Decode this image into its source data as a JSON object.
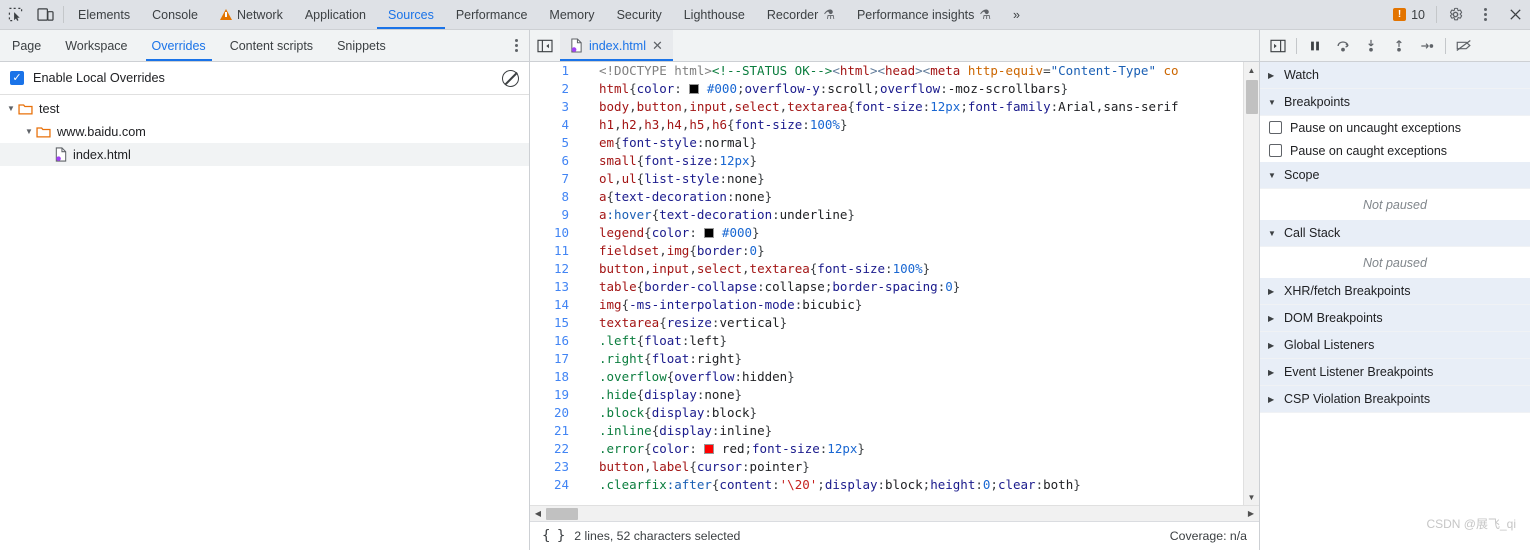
{
  "topbar": {
    "icons": [
      {
        "name": "inspect-element-icon"
      },
      {
        "name": "device-toolbar-icon"
      }
    ],
    "tabs": [
      {
        "label": "Elements",
        "active": false,
        "warn": false,
        "flask": false
      },
      {
        "label": "Console",
        "active": false,
        "warn": false,
        "flask": false
      },
      {
        "label": "Network",
        "active": false,
        "warn": true,
        "flask": false
      },
      {
        "label": "Application",
        "active": false,
        "warn": false,
        "flask": false
      },
      {
        "label": "Sources",
        "active": true,
        "warn": false,
        "flask": false
      },
      {
        "label": "Performance",
        "active": false,
        "warn": false,
        "flask": false
      },
      {
        "label": "Memory",
        "active": false,
        "warn": false,
        "flask": false
      },
      {
        "label": "Security",
        "active": false,
        "warn": false,
        "flask": false
      },
      {
        "label": "Lighthouse",
        "active": false,
        "warn": false,
        "flask": false
      },
      {
        "label": "Recorder",
        "active": false,
        "warn": false,
        "flask": true
      },
      {
        "label": "Performance insights",
        "active": false,
        "warn": false,
        "flask": true
      }
    ],
    "more_tabs_label": "»",
    "error_count": "10",
    "settings_icon": "gear-icon",
    "more_icon": "kebab-menu-icon",
    "close_icon": "close-icon"
  },
  "navigator": {
    "tabs": [
      {
        "label": "Page",
        "active": false
      },
      {
        "label": "Workspace",
        "active": false
      },
      {
        "label": "Overrides",
        "active": true
      },
      {
        "label": "Content scripts",
        "active": false
      },
      {
        "label": "Snippets",
        "active": false
      }
    ],
    "more_icon": "kebab-menu-icon",
    "overrides": {
      "checkbox_label": "Enable Local Overrides",
      "checkbox_checked": true,
      "checkmark": "✓",
      "clear_icon": "clear-overrides-icon"
    },
    "tree": [
      {
        "label": "test",
        "type": "folder",
        "depth": 0,
        "expanded": true,
        "selected": false
      },
      {
        "label": "www.baidu.com",
        "type": "folder",
        "depth": 1,
        "expanded": true,
        "selected": false
      },
      {
        "label": "index.html",
        "type": "file",
        "depth": 2,
        "expanded": false,
        "selected": true
      }
    ]
  },
  "editor": {
    "panel_toggle_icon": "show-navigator-icon",
    "tab": {
      "label": "index.html",
      "file_icon": "html-file-icon",
      "close_icon": "close-tab-icon"
    },
    "lines": [
      {
        "n": "1",
        "html": "<span class=\"s-doct\">&lt;!DOCTYPE html&gt;</span><span class=\"s-cmt\">&lt;!--STATUS OK--&gt;</span><span class=\"s-brack\">&lt;</span><span class=\"s-tag\">html</span><span class=\"s-brack\">&gt;&lt;</span><span class=\"s-tag\">head</span><span class=\"s-brack\">&gt;&lt;</span><span class=\"s-tag\">meta</span> <span class=\"s-attr\">http-equiv</span><span class=\"s-punct\">=</span><span class=\"s-attrv\">\"Content-Type\"</span> <span class=\"s-attr\">co</span>"
      },
      {
        "n": "2",
        "html": "<span class=\"s-sel\">html</span><span class=\"s-punct\">{</span><span class=\"s-prop\">color</span><span class=\"s-punct\">:</span> <span class=\"swatch-b\"></span> <span class=\"s-num\">#000</span><span class=\"s-punct\">;</span><span class=\"s-prop\">overflow-y</span><span class=\"s-punct\">:</span><span class=\"s-val\">scroll</span><span class=\"s-punct\">;</span><span class=\"s-prop\">overflow</span><span class=\"s-punct\">:</span><span class=\"s-val\">-moz-scrollbars</span><span class=\"s-punct\">}</span>"
      },
      {
        "n": "3",
        "html": "<span class=\"s-sel\">body</span><span class=\"s-punct\">,</span><span class=\"s-sel\">button</span><span class=\"s-punct\">,</span><span class=\"s-sel\">input</span><span class=\"s-punct\">,</span><span class=\"s-sel\">select</span><span class=\"s-punct\">,</span><span class=\"s-sel\">textarea</span><span class=\"s-punct\">{</span><span class=\"s-prop\">font-size</span><span class=\"s-punct\">:</span><span class=\"s-num\">12px</span><span class=\"s-punct\">;</span><span class=\"s-prop\">font-family</span><span class=\"s-punct\">:</span><span class=\"s-val\">Arial,sans-serif</span>"
      },
      {
        "n": "4",
        "html": "<span class=\"s-sel\">h1</span><span class=\"s-punct\">,</span><span class=\"s-sel\">h2</span><span class=\"s-punct\">,</span><span class=\"s-sel\">h3</span><span class=\"s-punct\">,</span><span class=\"s-sel\">h4</span><span class=\"s-punct\">,</span><span class=\"s-sel\">h5</span><span class=\"s-punct\">,</span><span class=\"s-sel\">h6</span><span class=\"s-punct\">{</span><span class=\"s-prop\">font-size</span><span class=\"s-punct\">:</span><span class=\"s-num\">100%</span><span class=\"s-punct\">}</span>"
      },
      {
        "n": "5",
        "html": "<span class=\"s-sel\">em</span><span class=\"s-punct\">{</span><span class=\"s-prop\">font-style</span><span class=\"s-punct\">:</span><span class=\"s-val\">normal</span><span class=\"s-punct\">}</span>"
      },
      {
        "n": "6",
        "html": "<span class=\"s-sel\">small</span><span class=\"s-punct\">{</span><span class=\"s-prop\">font-size</span><span class=\"s-punct\">:</span><span class=\"s-num\">12px</span><span class=\"s-punct\">}</span>"
      },
      {
        "n": "7",
        "html": "<span class=\"s-sel\">ol</span><span class=\"s-punct\">,</span><span class=\"s-sel\">ul</span><span class=\"s-punct\">{</span><span class=\"s-prop\">list-style</span><span class=\"s-punct\">:</span><span class=\"s-val\">none</span><span class=\"s-punct\">}</span>"
      },
      {
        "n": "8",
        "html": "<span class=\"s-sel\">a</span><span class=\"s-punct\">{</span><span class=\"s-prop\">text-decoration</span><span class=\"s-punct\">:</span><span class=\"s-val\">none</span><span class=\"s-punct\">}</span>"
      },
      {
        "n": "9",
        "html": "<span class=\"s-sel\">a</span><span class=\"s-pseu\">:hover</span><span class=\"s-punct\">{</span><span class=\"s-prop\">text-decoration</span><span class=\"s-punct\">:</span><span class=\"s-val\">underline</span><span class=\"s-punct\">}</span>"
      },
      {
        "n": "10",
        "html": "<span class=\"s-sel\">legend</span><span class=\"s-punct\">{</span><span class=\"s-prop\">color</span><span class=\"s-punct\">:</span> <span class=\"swatch-b\"></span> <span class=\"s-num\">#000</span><span class=\"s-punct\">}</span>"
      },
      {
        "n": "11",
        "html": "<span class=\"s-sel\">fieldset</span><span class=\"s-punct\">,</span><span class=\"s-sel\">img</span><span class=\"s-punct\">{</span><span class=\"s-prop\">border</span><span class=\"s-punct\">:</span><span class=\"s-num\">0</span><span class=\"s-punct\">}</span>"
      },
      {
        "n": "12",
        "html": "<span class=\"s-sel\">button</span><span class=\"s-punct\">,</span><span class=\"s-sel\">input</span><span class=\"s-punct\">,</span><span class=\"s-sel\">select</span><span class=\"s-punct\">,</span><span class=\"s-sel\">textarea</span><span class=\"s-punct\">{</span><span class=\"s-prop\">font-size</span><span class=\"s-punct\">:</span><span class=\"s-num\">100%</span><span class=\"s-punct\">}</span>"
      },
      {
        "n": "13",
        "html": "<span class=\"s-sel\">table</span><span class=\"s-punct\">{</span><span class=\"s-prop\">border-collapse</span><span class=\"s-punct\">:</span><span class=\"s-val\">collapse</span><span class=\"s-punct\">;</span><span class=\"s-prop\">border-spacing</span><span class=\"s-punct\">:</span><span class=\"s-num\">0</span><span class=\"s-punct\">}</span>"
      },
      {
        "n": "14",
        "html": "<span class=\"s-sel\">img</span><span class=\"s-punct\">{</span><span class=\"s-prop\">-ms-interpolation-mode</span><span class=\"s-punct\">:</span><span class=\"s-val\">bicubic</span><span class=\"s-punct\">}</span>"
      },
      {
        "n": "15",
        "html": "<span class=\"s-sel\">textarea</span><span class=\"s-punct\">{</span><span class=\"s-prop\">resize</span><span class=\"s-punct\">:</span><span class=\"s-val\">vertical</span><span class=\"s-punct\">}</span>"
      },
      {
        "n": "16",
        "html": "<span class=\"s-cls\">.left</span><span class=\"s-punct\">{</span><span class=\"s-prop\">float</span><span class=\"s-punct\">:</span><span class=\"s-val\">left</span><span class=\"s-punct\">}</span>"
      },
      {
        "n": "17",
        "html": "<span class=\"s-cls\">.right</span><span class=\"s-punct\">{</span><span class=\"s-prop\">float</span><span class=\"s-punct\">:</span><span class=\"s-val\">right</span><span class=\"s-punct\">}</span>"
      },
      {
        "n": "18",
        "html": "<span class=\"s-cls\">.overflow</span><span class=\"s-punct\">{</span><span class=\"s-prop\">overflow</span><span class=\"s-punct\">:</span><span class=\"s-val\">hidden</span><span class=\"s-punct\">}</span>"
      },
      {
        "n": "19",
        "html": "<span class=\"s-cls\">.hide</span><span class=\"s-punct\">{</span><span class=\"s-prop\">display</span><span class=\"s-punct\">:</span><span class=\"s-val\">none</span><span class=\"s-punct\">}</span>"
      },
      {
        "n": "20",
        "html": "<span class=\"s-cls\">.block</span><span class=\"s-punct\">{</span><span class=\"s-prop\">display</span><span class=\"s-punct\">:</span><span class=\"s-val\">block</span><span class=\"s-punct\">}</span>"
      },
      {
        "n": "21",
        "html": "<span class=\"s-cls\">.inline</span><span class=\"s-punct\">{</span><span class=\"s-prop\">display</span><span class=\"s-punct\">:</span><span class=\"s-val\">inline</span><span class=\"s-punct\">}</span>"
      },
      {
        "n": "22",
        "html": "<span class=\"s-cls\">.error</span><span class=\"s-punct\">{</span><span class=\"s-prop\">color</span><span class=\"s-punct\">:</span> <span class=\"swatch-r\"></span> <span class=\"s-val\">red</span><span class=\"s-punct\">;</span><span class=\"s-prop\">font-size</span><span class=\"s-punct\">:</span><span class=\"s-num\">12px</span><span class=\"s-punct\">}</span>"
      },
      {
        "n": "23",
        "html": "<span class=\"s-sel\">button</span><span class=\"s-punct\">,</span><span class=\"s-sel\">label</span><span class=\"s-punct\">{</span><span class=\"s-prop\">cursor</span><span class=\"s-punct\">:</span><span class=\"s-val\">pointer</span><span class=\"s-punct\">}</span>"
      },
      {
        "n": "24",
        "html": "<span class=\"s-cls\">.clearfix</span><span class=\"s-pseu\">:after</span><span class=\"s-punct\">{</span><span class=\"s-prop\">content</span><span class=\"s-punct\">:</span><span class=\"s-str\">'\\20'</span><span class=\"s-punct\">;</span><span class=\"s-prop\">display</span><span class=\"s-punct\">:</span><span class=\"s-val\">block</span><span class=\"s-punct\">;</span><span class=\"s-prop\">height</span><span class=\"s-punct\">:</span><span class=\"s-num\">0</span><span class=\"s-punct\">;</span><span class=\"s-prop\">clear</span><span class=\"s-punct\">:</span><span class=\"s-val\">both</span><span class=\"s-punct\">}</span>"
      }
    ],
    "statusbar": {
      "format_icon": "pretty-print-icon",
      "format_glyph": "{ }",
      "selection_text": "2 lines, 52 characters selected",
      "coverage_text": "Coverage: n/a"
    }
  },
  "debugger": {
    "toolbar_icons": [
      {
        "name": "show-debugger-sidebar-icon"
      },
      {
        "name": "pause-script-icon"
      },
      {
        "name": "step-over-icon"
      },
      {
        "name": "step-into-icon"
      },
      {
        "name": "step-out-icon"
      },
      {
        "name": "step-icon"
      },
      {
        "name": "deactivate-breakpoints-icon"
      }
    ],
    "sections": [
      {
        "label": "Watch",
        "expanded": false
      },
      {
        "label": "Breakpoints",
        "expanded": true
      },
      {
        "label": "Scope",
        "expanded": true
      },
      {
        "label": "Call Stack",
        "expanded": true
      },
      {
        "label": "XHR/fetch Breakpoints",
        "expanded": false
      },
      {
        "label": "DOM Breakpoints",
        "expanded": false
      },
      {
        "label": "Global Listeners",
        "expanded": false
      },
      {
        "label": "Event Listener Breakpoints",
        "expanded": false
      },
      {
        "label": "CSP Violation Breakpoints",
        "expanded": false
      }
    ],
    "breakpoint_options": [
      {
        "label": "Pause on uncaught exceptions",
        "checked": false
      },
      {
        "label": "Pause on caught exceptions",
        "checked": false
      }
    ],
    "scope_status": "Not paused",
    "callstack_status": "Not paused",
    "triangle_expanded": "▼",
    "triangle_collapsed": "▶"
  },
  "watermark": "CSDN @展飞_qi",
  "colors": {
    "accent": "#1a73e8",
    "toolbar_bg": "#dee1e6",
    "subtoolbar_bg": "#f1f3f4",
    "warning": "#e37400",
    "folder": "#e8710a",
    "override_dot": "#a142f4"
  }
}
